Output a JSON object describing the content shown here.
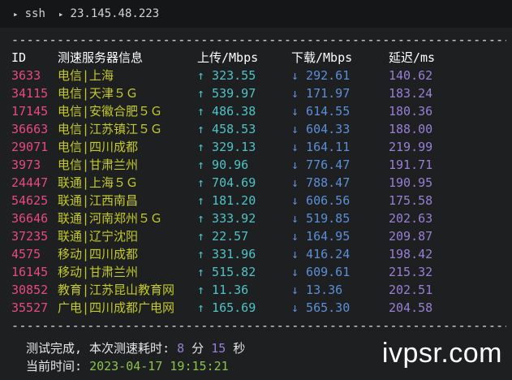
{
  "tab": {
    "crumbs": [
      "ssh",
      "23.145.48.223"
    ]
  },
  "divider": "--------------------------------------------------------------------",
  "headers": {
    "id": "ID",
    "name": "测速服务器信息",
    "up": "上传/Mbps",
    "down": "下载/Mbps",
    "latency": "延迟/ms"
  },
  "rows": [
    {
      "id": "3633",
      "name": "电信|上海",
      "up": "↑ 323.55",
      "down": "↓ 292.61",
      "latency": "140.62"
    },
    {
      "id": "34115",
      "name": "电信|天津５Ｇ",
      "up": "↑ 539.97",
      "down": "↓ 171.97",
      "latency": "183.24"
    },
    {
      "id": "17145",
      "name": "电信|安徽合肥５Ｇ",
      "up": "↑ 486.38",
      "down": "↓ 614.55",
      "latency": "180.36"
    },
    {
      "id": "36663",
      "name": "电信|江苏镇江５Ｇ",
      "up": "↑ 458.53",
      "down": "↓ 604.33",
      "latency": "188.00"
    },
    {
      "id": "29071",
      "name": "电信|四川成都",
      "up": "↑ 329.13",
      "down": "↓ 164.11",
      "latency": "219.99"
    },
    {
      "id": "3973",
      "name": "电信|甘肃兰州",
      "up": "↑ 90.96",
      "down": "↓ 776.47",
      "latency": "191.71"
    },
    {
      "id": "24447",
      "name": "联通|上海５Ｇ",
      "up": "↑ 704.69",
      "down": "↓ 788.47",
      "latency": "190.95"
    },
    {
      "id": "54625",
      "name": "联通|江西南昌",
      "up": "↑ 181.20",
      "down": "↓ 606.56",
      "latency": "175.58"
    },
    {
      "id": "36646",
      "name": "联通|河南郑州５Ｇ",
      "up": "↑ 333.92",
      "down": "↓ 519.85",
      "latency": "202.63"
    },
    {
      "id": "37235",
      "name": "联通|辽宁沈阳",
      "up": "↑ 22.57",
      "down": "↓ 164.95",
      "latency": "209.87"
    },
    {
      "id": "4575",
      "name": "移动|四川成都",
      "up": "↑ 331.96",
      "down": "↓ 416.24",
      "latency": "198.42"
    },
    {
      "id": "16145",
      "name": "移动|甘肃兰州",
      "up": "↑ 515.82",
      "down": "↓ 609.61",
      "latency": "215.32"
    },
    {
      "id": "30852",
      "name": "教育|江苏昆山教育网",
      "up": "↑ 11.36",
      "down": "↓ 13.36",
      "latency": "202.51"
    },
    {
      "id": "35527",
      "name": "广电|四川成都广电网",
      "up": "↑ 165.69",
      "down": "↓ 565.30",
      "latency": "204.58"
    }
  ],
  "footer": {
    "done_prefix": "测试完成, 本次测速耗时: ",
    "minutes": "8",
    "min_unit": " 分 ",
    "seconds": "15",
    "sec_unit": " 秒",
    "time_label": "当前时间: ",
    "time_value": "2023-04-17 19:15:21"
  },
  "watermark": "ivpsr.com",
  "colors": {
    "background": "#1d1f21",
    "id": "#e84a7f",
    "name": "#c5c92a",
    "upload": "#4fc3c7",
    "download": "#5b8fd6",
    "latency": "#9a7fd6",
    "time": "#8bc34a"
  }
}
